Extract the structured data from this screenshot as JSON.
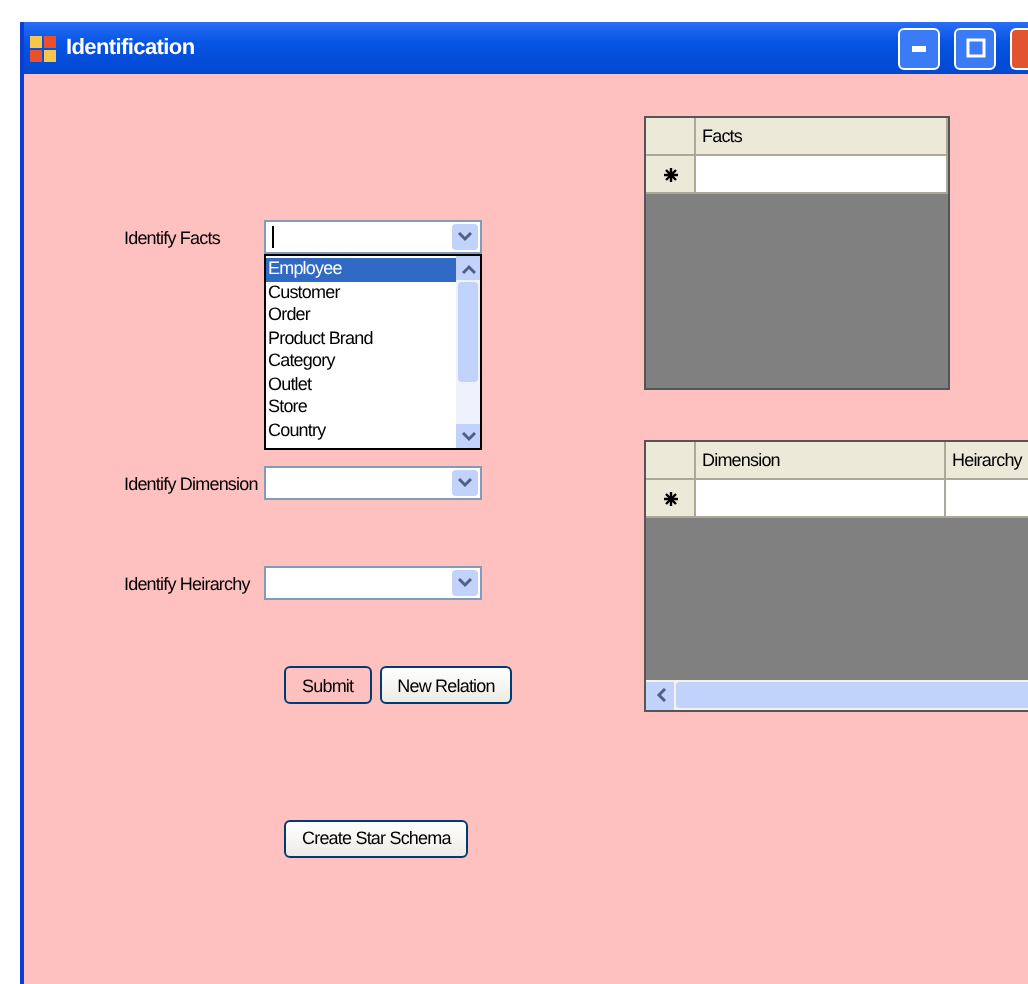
{
  "window": {
    "title": "Identification"
  },
  "fields": [
    {
      "label": "Identify Facts",
      "expanded": true,
      "options": [
        {
          "text": "Employee",
          "selected": true
        },
        {
          "text": "Customer",
          "selected": false
        },
        {
          "text": "Order",
          "selected": false
        },
        {
          "text": "Product Brand",
          "selected": false
        },
        {
          "text": "Category",
          "selected": false
        },
        {
          "text": "Outlet",
          "selected": false
        },
        {
          "text": "Store",
          "selected": false
        },
        {
          "text": "Country",
          "selected": false
        }
      ]
    },
    {
      "label": "Identify Dimension",
      "expanded": false
    },
    {
      "label": "Identify Heirarchy",
      "expanded": false
    }
  ],
  "action_buttons": [
    {
      "label": "Submit",
      "focused": true
    },
    {
      "label": "New Relation",
      "focused": false
    }
  ],
  "create_button": {
    "label": "Create Star Schema"
  },
  "grids": [
    {
      "columns": [
        "Facts"
      ],
      "scrollbar": false
    },
    {
      "columns": [
        "Dimension",
        "Heirarchy"
      ],
      "scrollbar": true
    }
  ]
}
